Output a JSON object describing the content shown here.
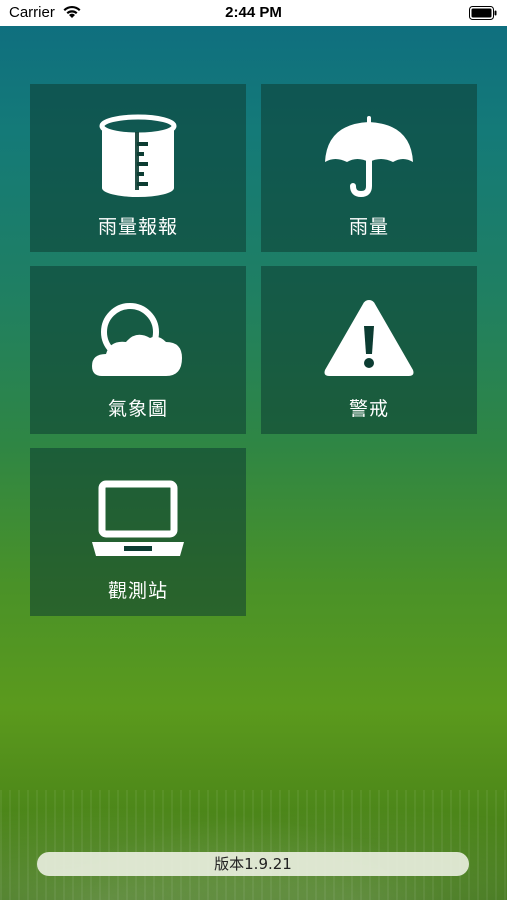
{
  "status_bar": {
    "carrier": "Carrier",
    "time": "2:44 PM",
    "wifi_icon": "wifi-icon",
    "battery_icon": "battery-icon"
  },
  "tiles": [
    {
      "label": "雨量報報",
      "icon": "rain-gauge-icon"
    },
    {
      "label": "雨量",
      "icon": "umbrella-icon"
    },
    {
      "label": "氣象圖",
      "icon": "cloud-sun-icon"
    },
    {
      "label": "警戒",
      "icon": "warning-icon"
    },
    {
      "label": "觀測站",
      "icon": "laptop-icon"
    }
  ],
  "version": "版本1.9.21",
  "colors": {
    "tile_bg": "#0c3c32",
    "gradient_top": "#0f6f7f",
    "gradient_bottom": "#3d7314"
  }
}
